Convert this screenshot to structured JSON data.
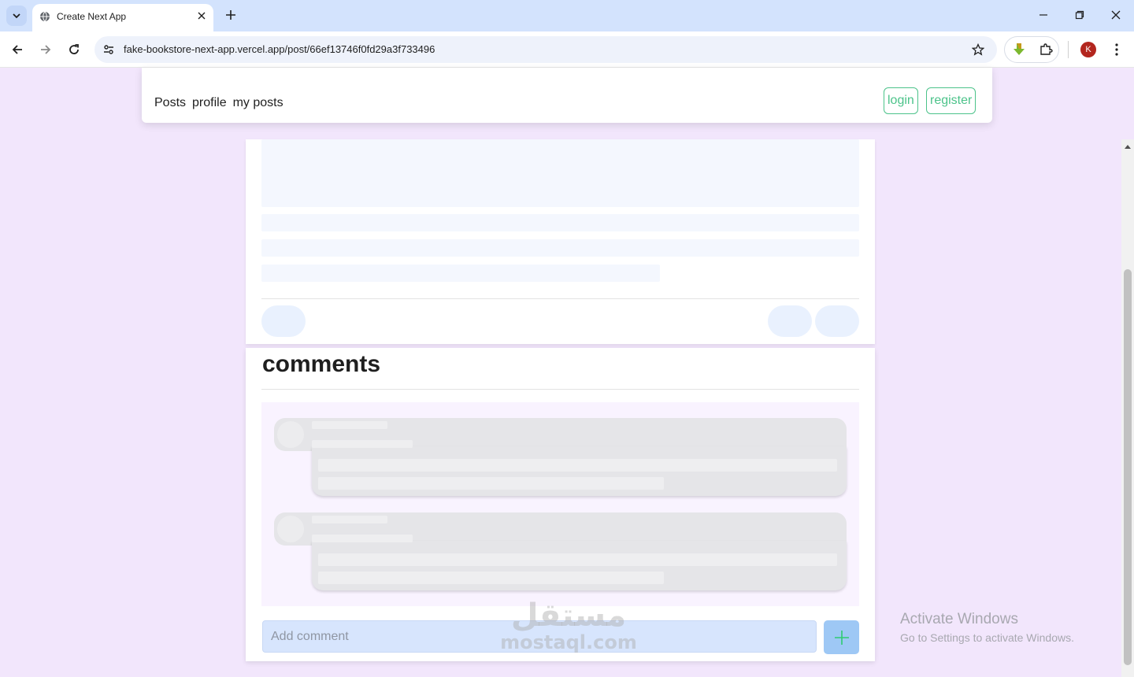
{
  "browser": {
    "tab_title": "Create Next App",
    "url": "fake-bookstore-next-app.vercel.app/post/66ef13746f0fd29a3f733496",
    "profile_initial": "K"
  },
  "header": {
    "nav": [
      "Posts",
      "profile",
      "my posts"
    ],
    "login_label": "login",
    "register_label": "register"
  },
  "comments": {
    "title": "comments",
    "input_placeholder": "Add comment"
  },
  "watermark": {
    "arabic": "مستقل",
    "latin": "mostaql.com"
  },
  "windows_notice": {
    "title": "Activate Windows",
    "subtitle": "Go to Settings to activate Windows."
  },
  "colors": {
    "page_bg": "#f2e6fc",
    "accent_green": "#4cc38a",
    "input_bg": "#d7e5fd",
    "add_button_bg": "#9ec8f5"
  },
  "icons": {
    "tab_search": "chevron-down-icon",
    "favicon": "globe-icon",
    "add_button": "plus-icon"
  }
}
